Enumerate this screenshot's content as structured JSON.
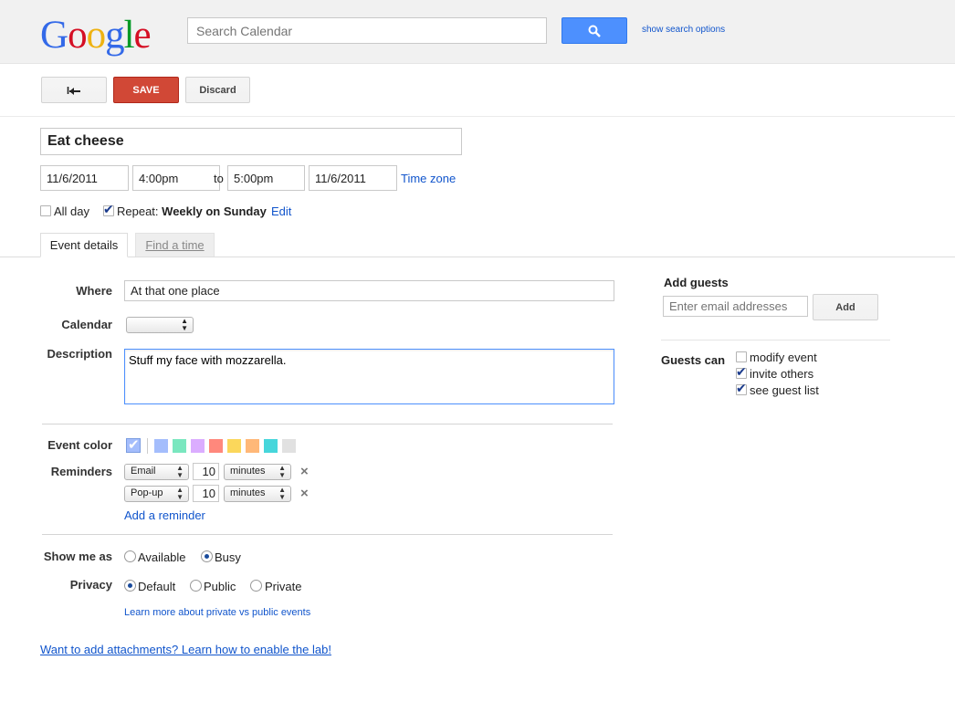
{
  "header": {
    "logo": [
      {
        "letter": "G",
        "color": "#3369e8"
      },
      {
        "letter": "o",
        "color": "#d50f25"
      },
      {
        "letter": "o",
        "color": "#eeb211"
      },
      {
        "letter": "g",
        "color": "#3369e8"
      },
      {
        "letter": "l",
        "color": "#009925"
      },
      {
        "letter": "e",
        "color": "#d50f25"
      }
    ],
    "search_placeholder": "Search Calendar",
    "search_options": "show search options"
  },
  "toolbar": {
    "back_icon": "back-arrow-icon",
    "save_label": "SAVE",
    "discard_label": "Discard"
  },
  "event": {
    "title": "Eat cheese",
    "start_date": "11/6/2011",
    "start_time": "4:00pm",
    "to_label": "to",
    "end_time": "5:00pm",
    "end_date": "11/6/2011",
    "timezone_link": "Time zone",
    "all_day_label": "All day",
    "all_day_checked": false,
    "repeat_label": "Repeat:",
    "repeat_value": "Weekly on Sunday",
    "repeat_checked": true,
    "repeat_edit": "Edit"
  },
  "tabs": [
    {
      "label": "Event details",
      "active": true
    },
    {
      "label": "Find a time",
      "active": false
    }
  ],
  "details": {
    "where_label": "Where",
    "where_value": "At that one place",
    "calendar_label": "Calendar",
    "description_label": "Description",
    "description_value": "Stuff my face with mozzarella.",
    "event_color_label": "Event color",
    "colors": [
      "#a4bdfc",
      "#7ae7bf",
      "#dbadff",
      "#ff887c",
      "#fbd75b",
      "#ffb878",
      "#46d6db",
      "#e1e1e1"
    ],
    "selected_color": "#a4bdfc",
    "reminders_label": "Reminders",
    "reminders": [
      {
        "method": "Email",
        "value": "10",
        "unit": "minutes"
      },
      {
        "method": "Pop-up",
        "value": "10",
        "unit": "minutes"
      }
    ],
    "add_reminder": "Add a reminder",
    "show_me_as_label": "Show me as",
    "show_me_as_options": [
      {
        "label": "Available",
        "selected": false
      },
      {
        "label": "Busy",
        "selected": true
      }
    ],
    "privacy_label": "Privacy",
    "privacy_options": [
      {
        "label": "Default",
        "selected": true
      },
      {
        "label": "Public",
        "selected": false
      },
      {
        "label": "Private",
        "selected": false
      }
    ],
    "learn_more": "Learn more about private vs public events",
    "attachments_link": "Want to add attachments? Learn how to enable the lab!"
  },
  "guests": {
    "add_guests_label": "Add guests",
    "email_placeholder": "Enter email addresses",
    "add_button": "Add",
    "guests_can_label": "Guests can",
    "permissions": [
      {
        "label": "modify event",
        "checked": false
      },
      {
        "label": "invite others",
        "checked": true
      },
      {
        "label": "see guest list",
        "checked": true
      }
    ]
  }
}
